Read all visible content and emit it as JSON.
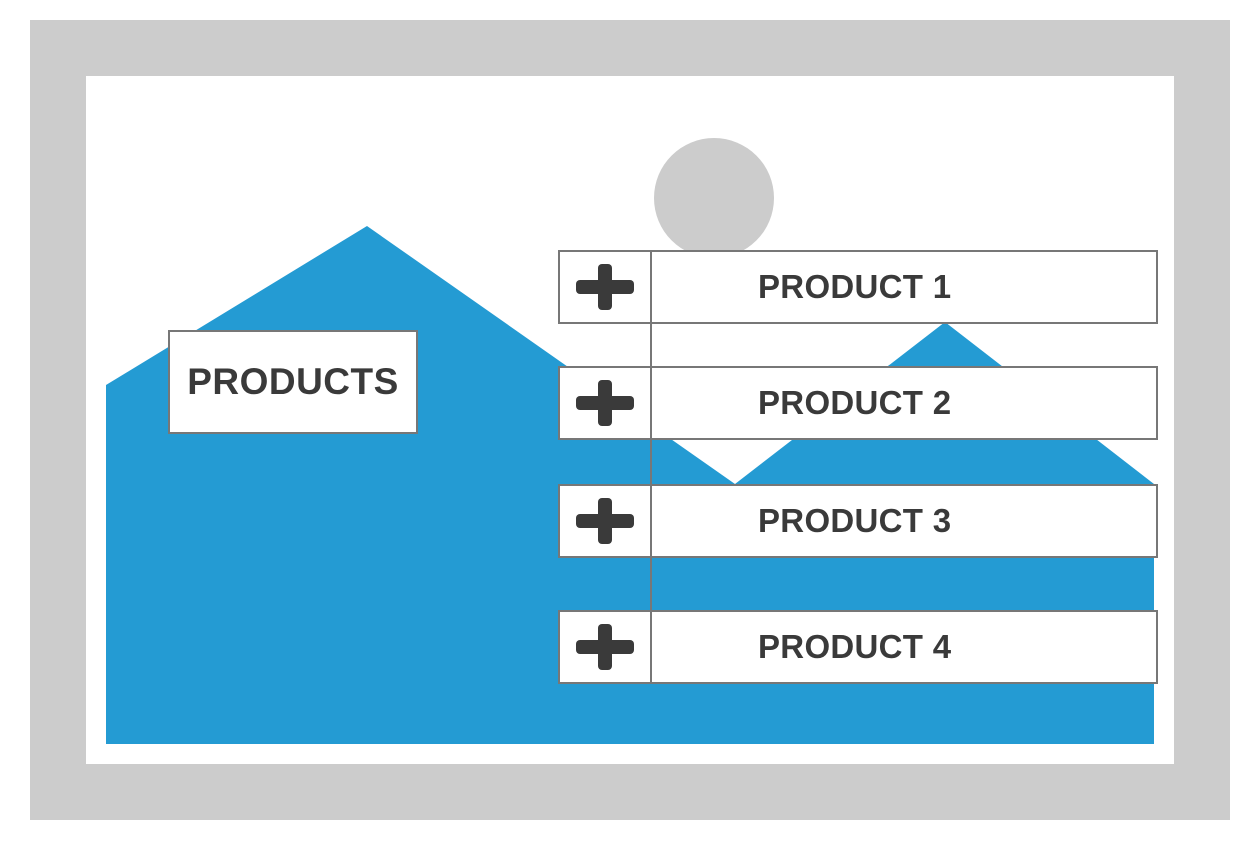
{
  "colors": {
    "frame": "#cccccc",
    "mountains": "#249bd3",
    "sun": "#cccccc",
    "box_border": "#777777",
    "text": "#3a3a3a"
  },
  "main_label": "PRODUCTS",
  "products": [
    {
      "label": "PRODUCT 1",
      "icon": "plus-icon"
    },
    {
      "label": "PRODUCT 2",
      "icon": "plus-icon"
    },
    {
      "label": "PRODUCT 3",
      "icon": "plus-icon"
    },
    {
      "label": "PRODUCT 4",
      "icon": "plus-icon"
    }
  ]
}
